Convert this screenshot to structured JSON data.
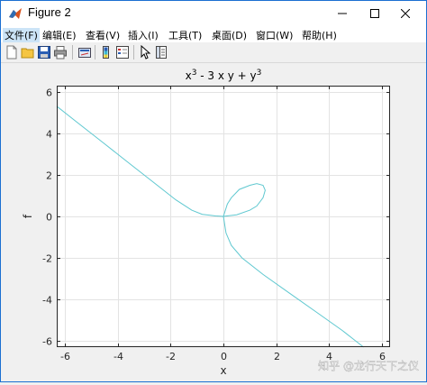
{
  "window": {
    "title": "Figure 2"
  },
  "menu": [
    "文件(F)",
    "编辑(E)",
    "查看(V)",
    "插入(I)",
    "工具(T)",
    "桌面(D)",
    "窗口(W)",
    "帮助(H)"
  ],
  "toolbar": [
    "new-figure",
    "open-file",
    "save",
    "print",
    "link-plot",
    "insert-colorbar",
    "insert-legend",
    "edit-plot",
    "property-inspector"
  ],
  "plot": {
    "title_base": "x",
    "title_sup1": "3",
    "title_mid": " - 3 x y + y",
    "title_sup2": "3",
    "xlabel": "x",
    "ylabel": "f"
  },
  "watermark": "知乎 @龙行天下之仪",
  "chart_data": {
    "type": "line",
    "title": "x^3 - 3 x y + y^3",
    "xlabel": "x",
    "ylabel": "f",
    "xlim": [
      -6.3,
      6.3
    ],
    "ylim": [
      -6.3,
      6.3
    ],
    "xticks": [
      -6,
      -4,
      -2,
      0,
      2,
      4,
      6
    ],
    "yticks": [
      -6,
      -4,
      -2,
      0,
      2,
      4,
      6
    ],
    "grid": true,
    "color": "#5fc8d0",
    "series": [
      {
        "x": [
          -6.3,
          -5.5,
          -4.5,
          -3.5,
          -2.5,
          -1.8,
          -1.2,
          -0.8,
          -0.5,
          -0.3,
          0,
          0.5,
          1.0,
          1.26,
          1.5,
          1.58,
          1.5,
          1.26,
          1.0,
          0.6,
          0.3,
          0.15,
          0,
          0.1,
          0.3,
          0.7,
          1.5,
          2.5,
          3.5,
          4.5,
          5.0,
          5.3
        ],
        "y": [
          5.31,
          4.5,
          3.5,
          2.5,
          1.5,
          0.8,
          0.3,
          0.1,
          0.05,
          0.02,
          0,
          0.08,
          0.3,
          0.5,
          0.9,
          1.26,
          1.5,
          1.58,
          1.5,
          1.3,
          0.9,
          0.6,
          0,
          -0.8,
          -1.4,
          -2.0,
          -2.8,
          -3.7,
          -4.6,
          -5.5,
          -6.0,
          -6.3
        ]
      }
    ]
  }
}
